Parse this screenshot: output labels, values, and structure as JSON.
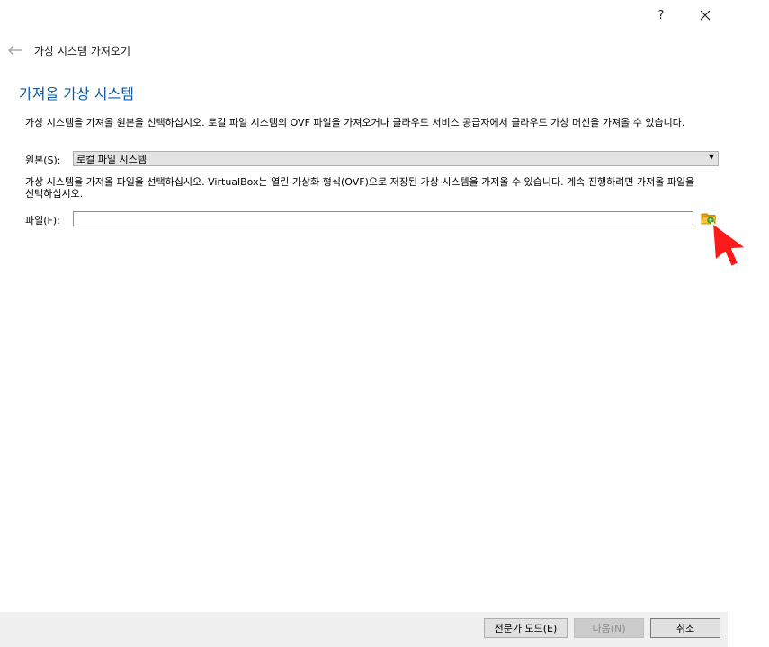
{
  "window": {
    "help_label": "?",
    "close_label": "✕"
  },
  "header": {
    "wizard_title": "가상 시스템 가져오기",
    "page_title": "가져올 가상 시스템"
  },
  "source_section": {
    "description": "가상 시스템을 가져올 원본을 선택하십시오. 로컬 파일 시스템의 OVF 파일을 가져오거나 클라우드 서비스 공급자에서 클라우드 가상 머신을 가져올 수 있습니다.",
    "label": "원본(S):",
    "selected_value": "로컬 파일 시스템"
  },
  "file_section": {
    "description": "가상 시스템을 가져올 파일을 선택하십시오. VirtualBox는 열린 가상화 형식(OVF)으로 저장된 가상 시스템을 가져올 수 있습니다. 계속 진행하려면 가져올 파일을 선택하십시오.",
    "label": "파일(F):",
    "value": "",
    "folder_icon": "folder-open-icon"
  },
  "footer": {
    "expert_mode_label": "전문가 모드(E)",
    "next_label": "다음(N)",
    "cancel_label": "취소"
  },
  "colors": {
    "title_blue": "#0f5aa3",
    "cursor_red": "#ff1a1a",
    "footer_bg": "#f0f0f0"
  }
}
